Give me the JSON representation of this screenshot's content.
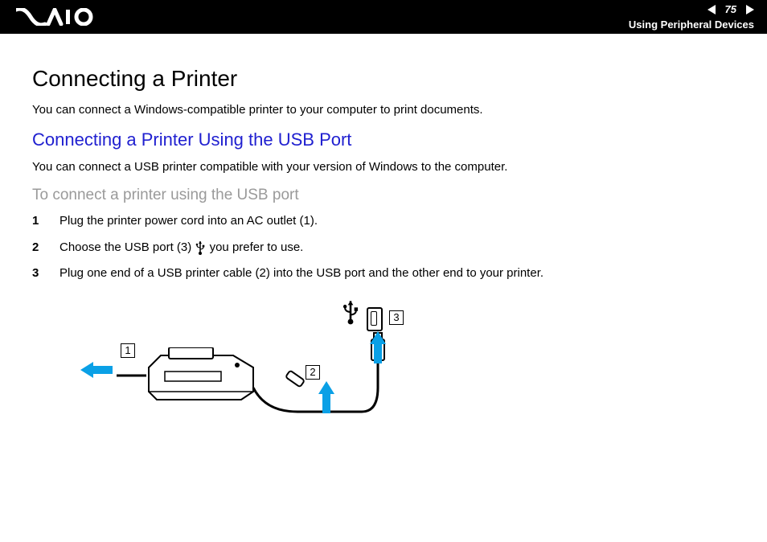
{
  "header": {
    "page_number": "75",
    "section": "Using Peripheral Devices"
  },
  "page": {
    "title": "Connecting a Printer",
    "intro": "You can connect a Windows-compatible printer to your computer to print documents.",
    "sub_title": "Connecting a Printer Using the USB Port",
    "sub_intro": "You can connect a USB printer compatible with your version of Windows to the computer.",
    "procedure_title": "To connect a printer using the USB port",
    "steps": {
      "s1": "Plug the printer power cord into an AC outlet (1).",
      "s2_a": "Choose the USB port (3) ",
      "s2_b": " you prefer to use.",
      "s3": "Plug one end of a USB printer cable (2) into the USB port and the other end to your printer."
    },
    "callouts": {
      "c1": "1",
      "c2": "2",
      "c3": "3"
    }
  }
}
